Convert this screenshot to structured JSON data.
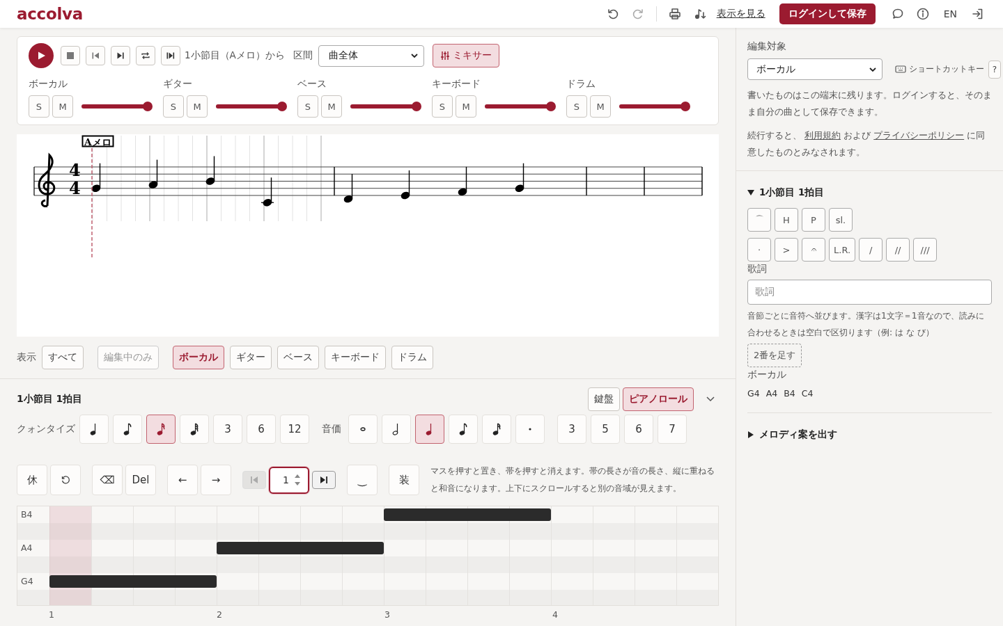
{
  "header": {
    "logo": "accolva",
    "redo_disabled": true,
    "view_link": "表示を見る",
    "login_button": "ログインして保存",
    "language": "EN"
  },
  "transport": {
    "position": "1小節目（Aメロ）から",
    "range_label": "区間",
    "range_value": "曲全体",
    "mixer_button": "ミキサー",
    "mixer_on": true,
    "tracks": [
      {
        "name": "ボーカル",
        "solo": "S",
        "mute": "M",
        "level": 1
      },
      {
        "name": "ギター",
        "solo": "S",
        "mute": "M",
        "level": 1
      },
      {
        "name": "ベース",
        "solo": "S",
        "mute": "M",
        "level": 1
      },
      {
        "name": "キーボード",
        "solo": "S",
        "mute": "M",
        "level": 1
      },
      {
        "name": "ドラム",
        "solo": "S",
        "mute": "M",
        "level": 1
      }
    ]
  },
  "score": {
    "rehearsal_mark": "Aメロ",
    "time_signature": [
      "4",
      "4"
    ],
    "measures": [
      {
        "kind": "notes",
        "notes": [
          {
            "kind": "g4"
          },
          {
            "kind": "a4"
          },
          {
            "kind": "b4"
          },
          {
            "kind": "c4"
          }
        ]
      },
      {
        "kind": "notes",
        "notes": [
          {
            "kind": "d4"
          },
          {
            "kind": "e4"
          },
          {
            "kind": "f4"
          },
          {
            "kind": "g4"
          }
        ]
      },
      {
        "kind": "empty"
      },
      {
        "kind": "empty"
      }
    ]
  },
  "view_filter": {
    "label": "表示",
    "buttons": [
      {
        "label": "すべて",
        "selected": false,
        "disabled": false
      },
      {
        "label": "編集中のみ",
        "selected": false,
        "disabled": true
      },
      {
        "label": "ボーカル",
        "selected": true,
        "disabled": false
      },
      {
        "label": "ギター",
        "selected": false,
        "disabled": false
      },
      {
        "label": "ベース",
        "selected": false,
        "disabled": false
      },
      {
        "label": "キーボード",
        "selected": false,
        "disabled": false
      },
      {
        "label": "ドラム",
        "selected": false,
        "disabled": false
      }
    ]
  },
  "editor": {
    "title": "1小節目 1拍目",
    "modes": [
      {
        "label": "鍵盤",
        "selected": false
      },
      {
        "label": "ピアノロール",
        "selected": true
      }
    ],
    "quantize": {
      "label": "クォンタイズ",
      "options": [
        {
          "kind": "quarter",
          "selected": false
        },
        {
          "kind": "eighth",
          "selected": false
        },
        {
          "kind": "sixteenth",
          "selected": true
        },
        {
          "kind": "thirty-second",
          "selected": false
        },
        {
          "kind": "text",
          "label": "3",
          "selected": false
        },
        {
          "kind": "text",
          "label": "6",
          "selected": false
        },
        {
          "kind": "text",
          "label": "12",
          "selected": false
        }
      ]
    },
    "duration": {
      "label": "音価",
      "options": [
        {
          "kind": "whole",
          "selected": false
        },
        {
          "kind": "half",
          "selected": false
        },
        {
          "kind": "quarter",
          "selected": true
        },
        {
          "kind": "eighth",
          "selected": false
        },
        {
          "kind": "sixteenth",
          "selected": false
        },
        {
          "kind": "dot",
          "selected": false
        }
      ],
      "tuplets": [
        {
          "label": "3",
          "selected": false
        },
        {
          "label": "5",
          "selected": false
        },
        {
          "label": "6",
          "selected": false
        },
        {
          "label": "7",
          "selected": false
        }
      ]
    },
    "tools": [
      {
        "kind": "text",
        "label": "休"
      },
      {
        "kind": "reset"
      },
      {
        "kind": "text",
        "label": "⌫"
      },
      {
        "kind": "text",
        "label": "Del"
      },
      {
        "kind": "text",
        "label": "←"
      },
      {
        "kind": "text",
        "label": "→"
      },
      {
        "kind": "first",
        "disabled": true
      },
      {
        "kind": "number",
        "value": "1"
      },
      {
        "kind": "last",
        "disabled": false
      },
      {
        "kind": "text",
        "label": "‿"
      },
      {
        "kind": "text",
        "label": "装"
      }
    ],
    "hint": "マスを押すと置き、帯を押すと消えます。帯の長さが音の長さ、縦に重ねると和音になります。上下にスクロールすると別の音域が見えます。"
  },
  "piano_roll": {
    "columns": [
      {
        "cursor": true
      },
      {
        "cursor": false
      },
      {
        "cursor": false
      },
      {
        "cursor": false
      },
      {
        "cursor": false
      },
      {
        "cursor": false
      },
      {
        "cursor": false
      },
      {
        "cursor": false
      },
      {
        "cursor": false
      },
      {
        "cursor": false
      },
      {
        "cursor": false
      },
      {
        "cursor": false
      },
      {
        "cursor": false
      },
      {
        "cursor": false
      },
      {
        "cursor": false
      },
      {
        "cursor": false
      }
    ],
    "rows": [
      {
        "label": "B4",
        "kind": "white",
        "measures": [
          false,
          false,
          true,
          false
        ]
      },
      {
        "kind": "black",
        "measures": [
          false,
          false,
          false,
          false
        ]
      },
      {
        "label": "A4",
        "kind": "white",
        "measures": [
          false,
          true,
          false,
          false
        ]
      },
      {
        "kind": "black",
        "measures": [
          false,
          false,
          false,
          false
        ]
      },
      {
        "label": "G4",
        "kind": "white",
        "measures": [
          true,
          false,
          false,
          false
        ]
      },
      {
        "kind": "black",
        "measures": [
          false,
          false,
          false,
          false
        ]
      }
    ],
    "bar_numbers": [
      "1",
      "2",
      "3",
      "4"
    ]
  },
  "side": {
    "target_label": "編集対象",
    "target_value": "ボーカル",
    "shortcut_label": "ショートカットキー",
    "shortcut_button": "?",
    "note": "書いたものはこの端末に残ります。ログインすると、そのまま自分の曲として保存できます。",
    "terms_before": "続行すると、",
    "terms_link": "利用規約",
    "terms_middle": "および",
    "privacy_link": "プライバシーポリシー",
    "terms_after": "に同意したものとみなされます。",
    "section": {
      "title": "1小節目 1拍目",
      "expanded": true
    },
    "techniques": [
      {
        "label": "⌒"
      },
      {
        "label": "H"
      },
      {
        "label": "P"
      },
      {
        "label": "sl."
      }
    ],
    "articulations": [
      {
        "label": "·"
      },
      {
        "label": ">"
      },
      {
        "label": "𝄐"
      },
      {
        "label": "L.R."
      },
      {
        "label": "/"
      },
      {
        "label": "//"
      },
      {
        "label": "///"
      }
    ],
    "lyrics_label": "歌詞",
    "lyrics_placeholder": "歌詞",
    "lyrics_hint": "音節ごとに音符へ並びます。漢字は1文字＝1音なので、読みに合わせるときは空白で区切ります（例: は な び）",
    "add_verse": "2番を足す",
    "track_label": "ボーカル",
    "pitches": [
      "G4",
      "A4",
      "B4",
      "C4"
    ],
    "melody": {
      "title": "メロディ案を出す",
      "expanded": false
    }
  }
}
